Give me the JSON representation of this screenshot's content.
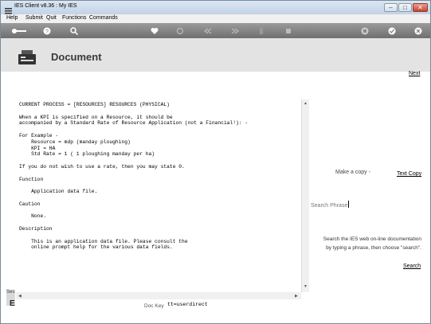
{
  "window": {
    "title": "IES Client v8.36 : My IES"
  },
  "menu": {
    "items": [
      "Help",
      "Submit",
      "Quit",
      "Functions",
      "Commands"
    ]
  },
  "toolbar": {
    "icons": [
      "key-icon",
      "help-icon",
      "search-icon",
      "heart-icon",
      "refresh-icon",
      "rewind-icon",
      "forward-icon",
      "bookmark-icon",
      "stop-icon",
      "print-icon",
      "check-icon",
      "close-icon"
    ]
  },
  "header": {
    "title": "Document"
  },
  "nav": {
    "next": "Next"
  },
  "doc": {
    "lines": [
      "CURRENT PROCESS = [RESOURCES] RESOURCES (PHYSICAL)",
      "",
      "When a KPI is specified on a Resource, it should be",
      "accompanied by a Standard Rate of Resource Application (not a Financial!): -",
      "",
      "For Example -",
      "    Resource = mdp (manday ploughing)",
      "    KPI = HA",
      "    Std Rate = 1 ( 1 ploughing manday per ha)",
      "",
      "If you do not wish to use a rate, then you may state 0.",
      "",
      "Function",
      "",
      "    Application data file.",
      "",
      "Caution",
      "",
      "    None.",
      "",
      "Description",
      "",
      "    This is an application data file. Please consult the",
      "    online prompt help for the various data fields."
    ]
  },
  "side": {
    "make_copy": "Make a copy -",
    "text_copy": "Text Copy",
    "search_phrase_label": "Search Phrase",
    "search_value": "",
    "help_line1": "Search the IES web on-line documentation",
    "help_line2": "by typing a phrase, then choose \"search\".",
    "search_link": "Search"
  },
  "footer": {
    "doc_key_label": "Doc Key",
    "doc_key_value": "tt=userdirect",
    "side_tab": "Ses"
  },
  "colors": {
    "toolbar": "#7f7f7f",
    "header": "#e3e3e3",
    "titlebar": "#c3d3e6"
  }
}
